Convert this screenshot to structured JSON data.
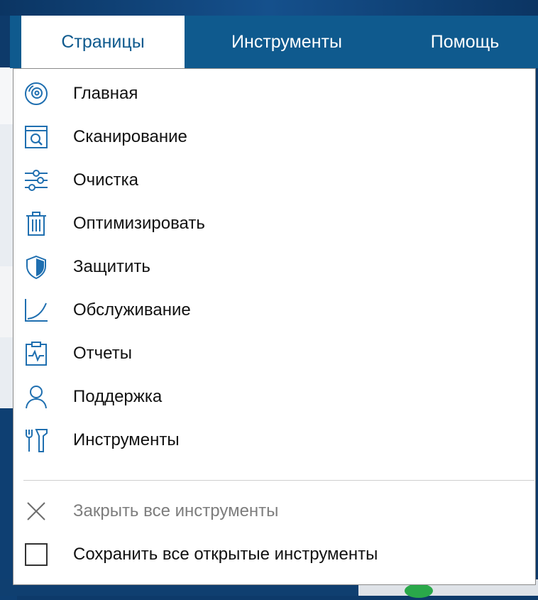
{
  "menubar": {
    "tabs": [
      {
        "label": "Страницы",
        "active": true
      },
      {
        "label": "Инструменты",
        "active": false
      },
      {
        "label": "Помощь",
        "active": false
      }
    ]
  },
  "dropdown": {
    "items": [
      {
        "label": "Главная",
        "icon": "home-disc-icon"
      },
      {
        "label": "Сканирование",
        "icon": "scan-icon"
      },
      {
        "label": "Очистка",
        "icon": "sliders-icon"
      },
      {
        "label": "Оптимизировать",
        "icon": "trash-icon"
      },
      {
        "label": "Защитить",
        "icon": "shield-icon"
      },
      {
        "label": "Обслуживание",
        "icon": "chart-curve-icon"
      },
      {
        "label": "Отчеты",
        "icon": "clipboard-pulse-icon"
      },
      {
        "label": "Поддержка",
        "icon": "user-icon"
      },
      {
        "label": "Инструменты",
        "icon": "tools-icon"
      }
    ],
    "actions": [
      {
        "label": "Закрыть все инструменты",
        "icon": "close-icon",
        "disabled": true
      },
      {
        "label": "Сохранить все открытые инструменты",
        "icon": "checkbox-icon",
        "disabled": false,
        "checked": false
      }
    ]
  },
  "colors": {
    "accent": "#0f5a8e",
    "icon": "#1f6fb0",
    "disabled": "#7d7d7d"
  }
}
